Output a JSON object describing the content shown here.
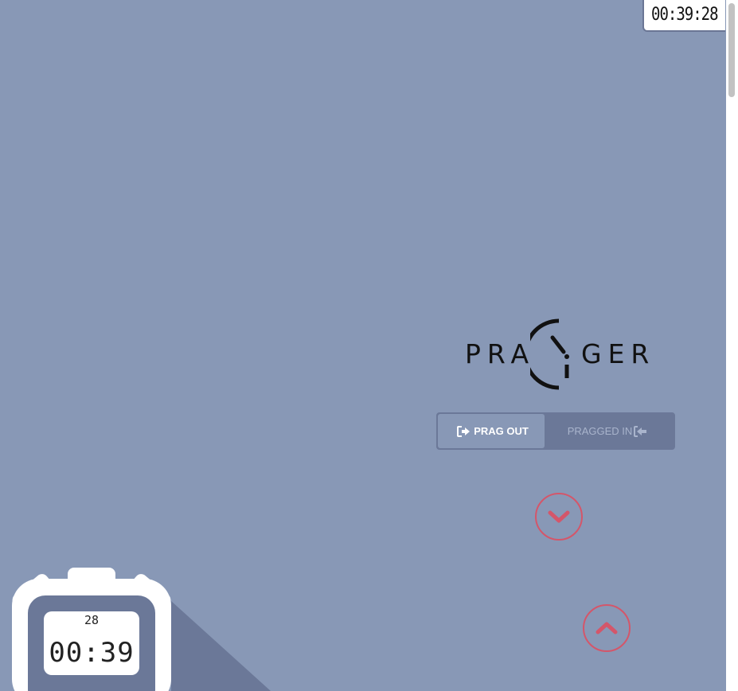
{
  "top_timer": {
    "time": "00:39:28"
  },
  "logo": {
    "left_text": "PRA",
    "right_text": "GER"
  },
  "toggle": {
    "prag_out_label": "PRAG OUT",
    "pragged_in_label": "PRAGGED IN"
  },
  "stopwatch": {
    "seconds": "28",
    "time": "00:39"
  },
  "colors": {
    "background": "#8898b6",
    "dark_panel": "#6b7898",
    "accent_red": "#d4566a",
    "white": "#ffffff"
  },
  "icons": [
    "sign-out-icon",
    "sign-in-icon",
    "chevron-down-icon",
    "chevron-up-icon",
    "stopwatch-icon",
    "logo-clock-icon"
  ]
}
